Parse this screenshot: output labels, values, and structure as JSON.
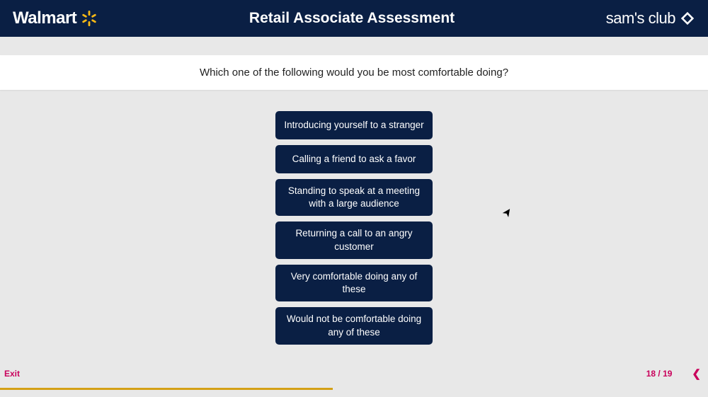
{
  "header": {
    "brand_left": "Walmart",
    "title": "Retail Associate Assessment",
    "brand_right": "sam's club"
  },
  "question": "Which one of the following would you be most comfortable doing?",
  "options": [
    "Introducing yourself to a stranger",
    "Calling a friend to ask a favor",
    "Standing to speak at a meeting with a large audience",
    "Returning a call to an angry customer",
    "Very comfortable doing any of these",
    "Would not be comfortable doing any of these"
  ],
  "footer": {
    "exit_label": "Exit",
    "page_counter": "18 / 19",
    "progress_percent": 47
  },
  "colors": {
    "header_bg": "#0a1f44",
    "accent_yellow": "#f9b915",
    "accent_pink": "#c9005b"
  }
}
